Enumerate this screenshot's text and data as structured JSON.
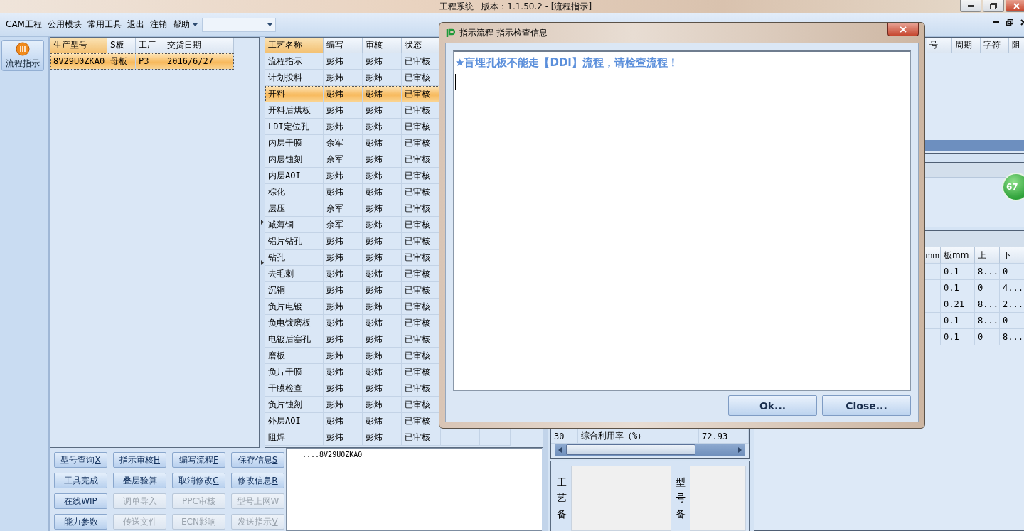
{
  "window": {
    "title": "工程系统   版本：1.1.50.2 - [流程指示]"
  },
  "menu": [
    "CAM工程",
    "公用模块",
    "常用工具",
    "退出",
    "注销",
    "帮助"
  ],
  "nav": [
    {
      "label": "流程指示"
    }
  ],
  "model_grid": {
    "columns": [
      "生产型号",
      "S板",
      "工厂",
      "交货日期"
    ],
    "rows": [
      {
        "cells": [
          "8V29U0ZKA0",
          "母板",
          "P3",
          "2016/6/27"
        ],
        "selected": true
      }
    ]
  },
  "process_grid": {
    "columns": [
      "工艺名称",
      "编写",
      "审核",
      "状态"
    ],
    "rows": [
      {
        "cells": [
          "流程指示",
          "彭炜",
          "彭炜",
          "已审核"
        ],
        "selected": false
      },
      {
        "cells": [
          "计划投料",
          "彭炜",
          "彭炜",
          "已审核"
        ],
        "selected": false
      },
      {
        "cells": [
          "开料",
          "彭炜",
          "彭炜",
          "已审核"
        ],
        "selected": true
      },
      {
        "cells": [
          "开料后烘板",
          "彭炜",
          "彭炜",
          "已审核"
        ],
        "selected": false
      },
      {
        "cells": [
          "LDI定位孔",
          "彭炜",
          "彭炜",
          "已审核"
        ],
        "selected": false
      },
      {
        "cells": [
          "内层干膜",
          "余军",
          "彭炜",
          "已审核"
        ],
        "selected": false
      },
      {
        "cells": [
          "内层蚀刻",
          "余军",
          "彭炜",
          "已审核"
        ],
        "selected": false
      },
      {
        "cells": [
          "内层AOI",
          "彭炜",
          "彭炜",
          "已审核"
        ],
        "selected": false
      },
      {
        "cells": [
          "棕化",
          "彭炜",
          "彭炜",
          "已审核"
        ],
        "selected": false
      },
      {
        "cells": [
          "层压",
          "余军",
          "彭炜",
          "已审核"
        ],
        "selected": false
      },
      {
        "cells": [
          "减薄铜",
          "余军",
          "彭炜",
          "已审核"
        ],
        "selected": false
      },
      {
        "cells": [
          "铝片钻孔",
          "彭炜",
          "彭炜",
          "已审核"
        ],
        "selected": false
      },
      {
        "cells": [
          "钻孔",
          "彭炜",
          "彭炜",
          "已审核"
        ],
        "selected": false
      },
      {
        "cells": [
          "去毛刺",
          "彭炜",
          "彭炜",
          "已审核"
        ],
        "selected": false
      },
      {
        "cells": [
          "沉铜",
          "彭炜",
          "彭炜",
          "已审核"
        ],
        "selected": false
      },
      {
        "cells": [
          "负片电镀",
          "彭炜",
          "彭炜",
          "已审核"
        ],
        "selected": false
      },
      {
        "cells": [
          "负电镀磨板",
          "彭炜",
          "彭炜",
          "已审核"
        ],
        "selected": false
      },
      {
        "cells": [
          "电镀后塞孔",
          "彭炜",
          "彭炜",
          "已审核"
        ],
        "selected": false
      },
      {
        "cells": [
          "磨板",
          "彭炜",
          "彭炜",
          "已审核"
        ],
        "selected": false
      },
      {
        "cells": [
          "负片干膜",
          "彭炜",
          "彭炜",
          "已审核"
        ],
        "selected": false
      },
      {
        "cells": [
          "干膜检查",
          "彭炜",
          "彭炜",
          "已审核"
        ],
        "selected": false
      },
      {
        "cells": [
          "负片蚀刻",
          "彭炜",
          "彭炜",
          "已审核"
        ],
        "selected": false
      },
      {
        "cells": [
          "外层AOI",
          "彭炜",
          "彭炜",
          "已审核"
        ],
        "selected": false
      },
      {
        "cells": [
          "阻焊",
          "彭炜",
          "彭炜",
          "已审核"
        ],
        "selected": false
      }
    ]
  },
  "actions": [
    {
      "label": "型号查询",
      "shortcut": "X",
      "disabled": false
    },
    {
      "label": "指示审核",
      "shortcut": "H",
      "disabled": false
    },
    {
      "label": "编写流程",
      "shortcut": "F",
      "disabled": false
    },
    {
      "label": "保存信息",
      "shortcut": "S",
      "disabled": false
    },
    {
      "label": "工具完成",
      "disabled": false
    },
    {
      "label": "叠层验算",
      "disabled": false
    },
    {
      "label": "取消修改",
      "shortcut": "C",
      "disabled": false
    },
    {
      "label": "修改信息",
      "shortcut": "R",
      "disabled": false
    },
    {
      "label": "在线WIP",
      "disabled": false
    },
    {
      "label": "调单导入",
      "disabled": true
    },
    {
      "label": "PPC审核",
      "disabled": true
    },
    {
      "label": "型号上网",
      "shortcut": "W",
      "disabled": true
    },
    {
      "label": "能力参数",
      "disabled": false
    },
    {
      "label": "传送文件",
      "disabled": true
    },
    {
      "label": "ECN影响",
      "disabled": true
    },
    {
      "label": "发送指示",
      "shortcut": "V",
      "disabled": true
    }
  ],
  "output": {
    "text": "....8V29U0ZKA0"
  },
  "usage_grid": {
    "rows": [
      {
        "cells": [
          "30",
          "综合利用率（%）",
          "72.93"
        ]
      }
    ]
  },
  "notes": [
    {
      "label": "工艺备"
    },
    {
      "label": "型号备"
    }
  ],
  "right_grid": {
    "columns": [
      "号",
      "周期",
      "字符",
      "阻"
    ]
  },
  "badge": "67",
  "layer_grid": {
    "columns": [
      "mm",
      "板mm",
      "上",
      "下"
    ],
    "rows": [
      [
        "",
        "0.1",
        "8...",
        "0"
      ],
      [
        "",
        "0.1",
        "0",
        "4..."
      ],
      [
        "",
        "0.21",
        "8...",
        "2..."
      ],
      [
        "",
        "0.1",
        "8...",
        "0"
      ],
      [
        "",
        "0.1",
        "0",
        "8..."
      ]
    ]
  },
  "dialog": {
    "title": "指示流程-指示检查信息",
    "message": "★盲埋孔板不能走【DDI】流程，请检查流程！",
    "buttons": [
      "Ok...",
      "Close..."
    ]
  }
}
